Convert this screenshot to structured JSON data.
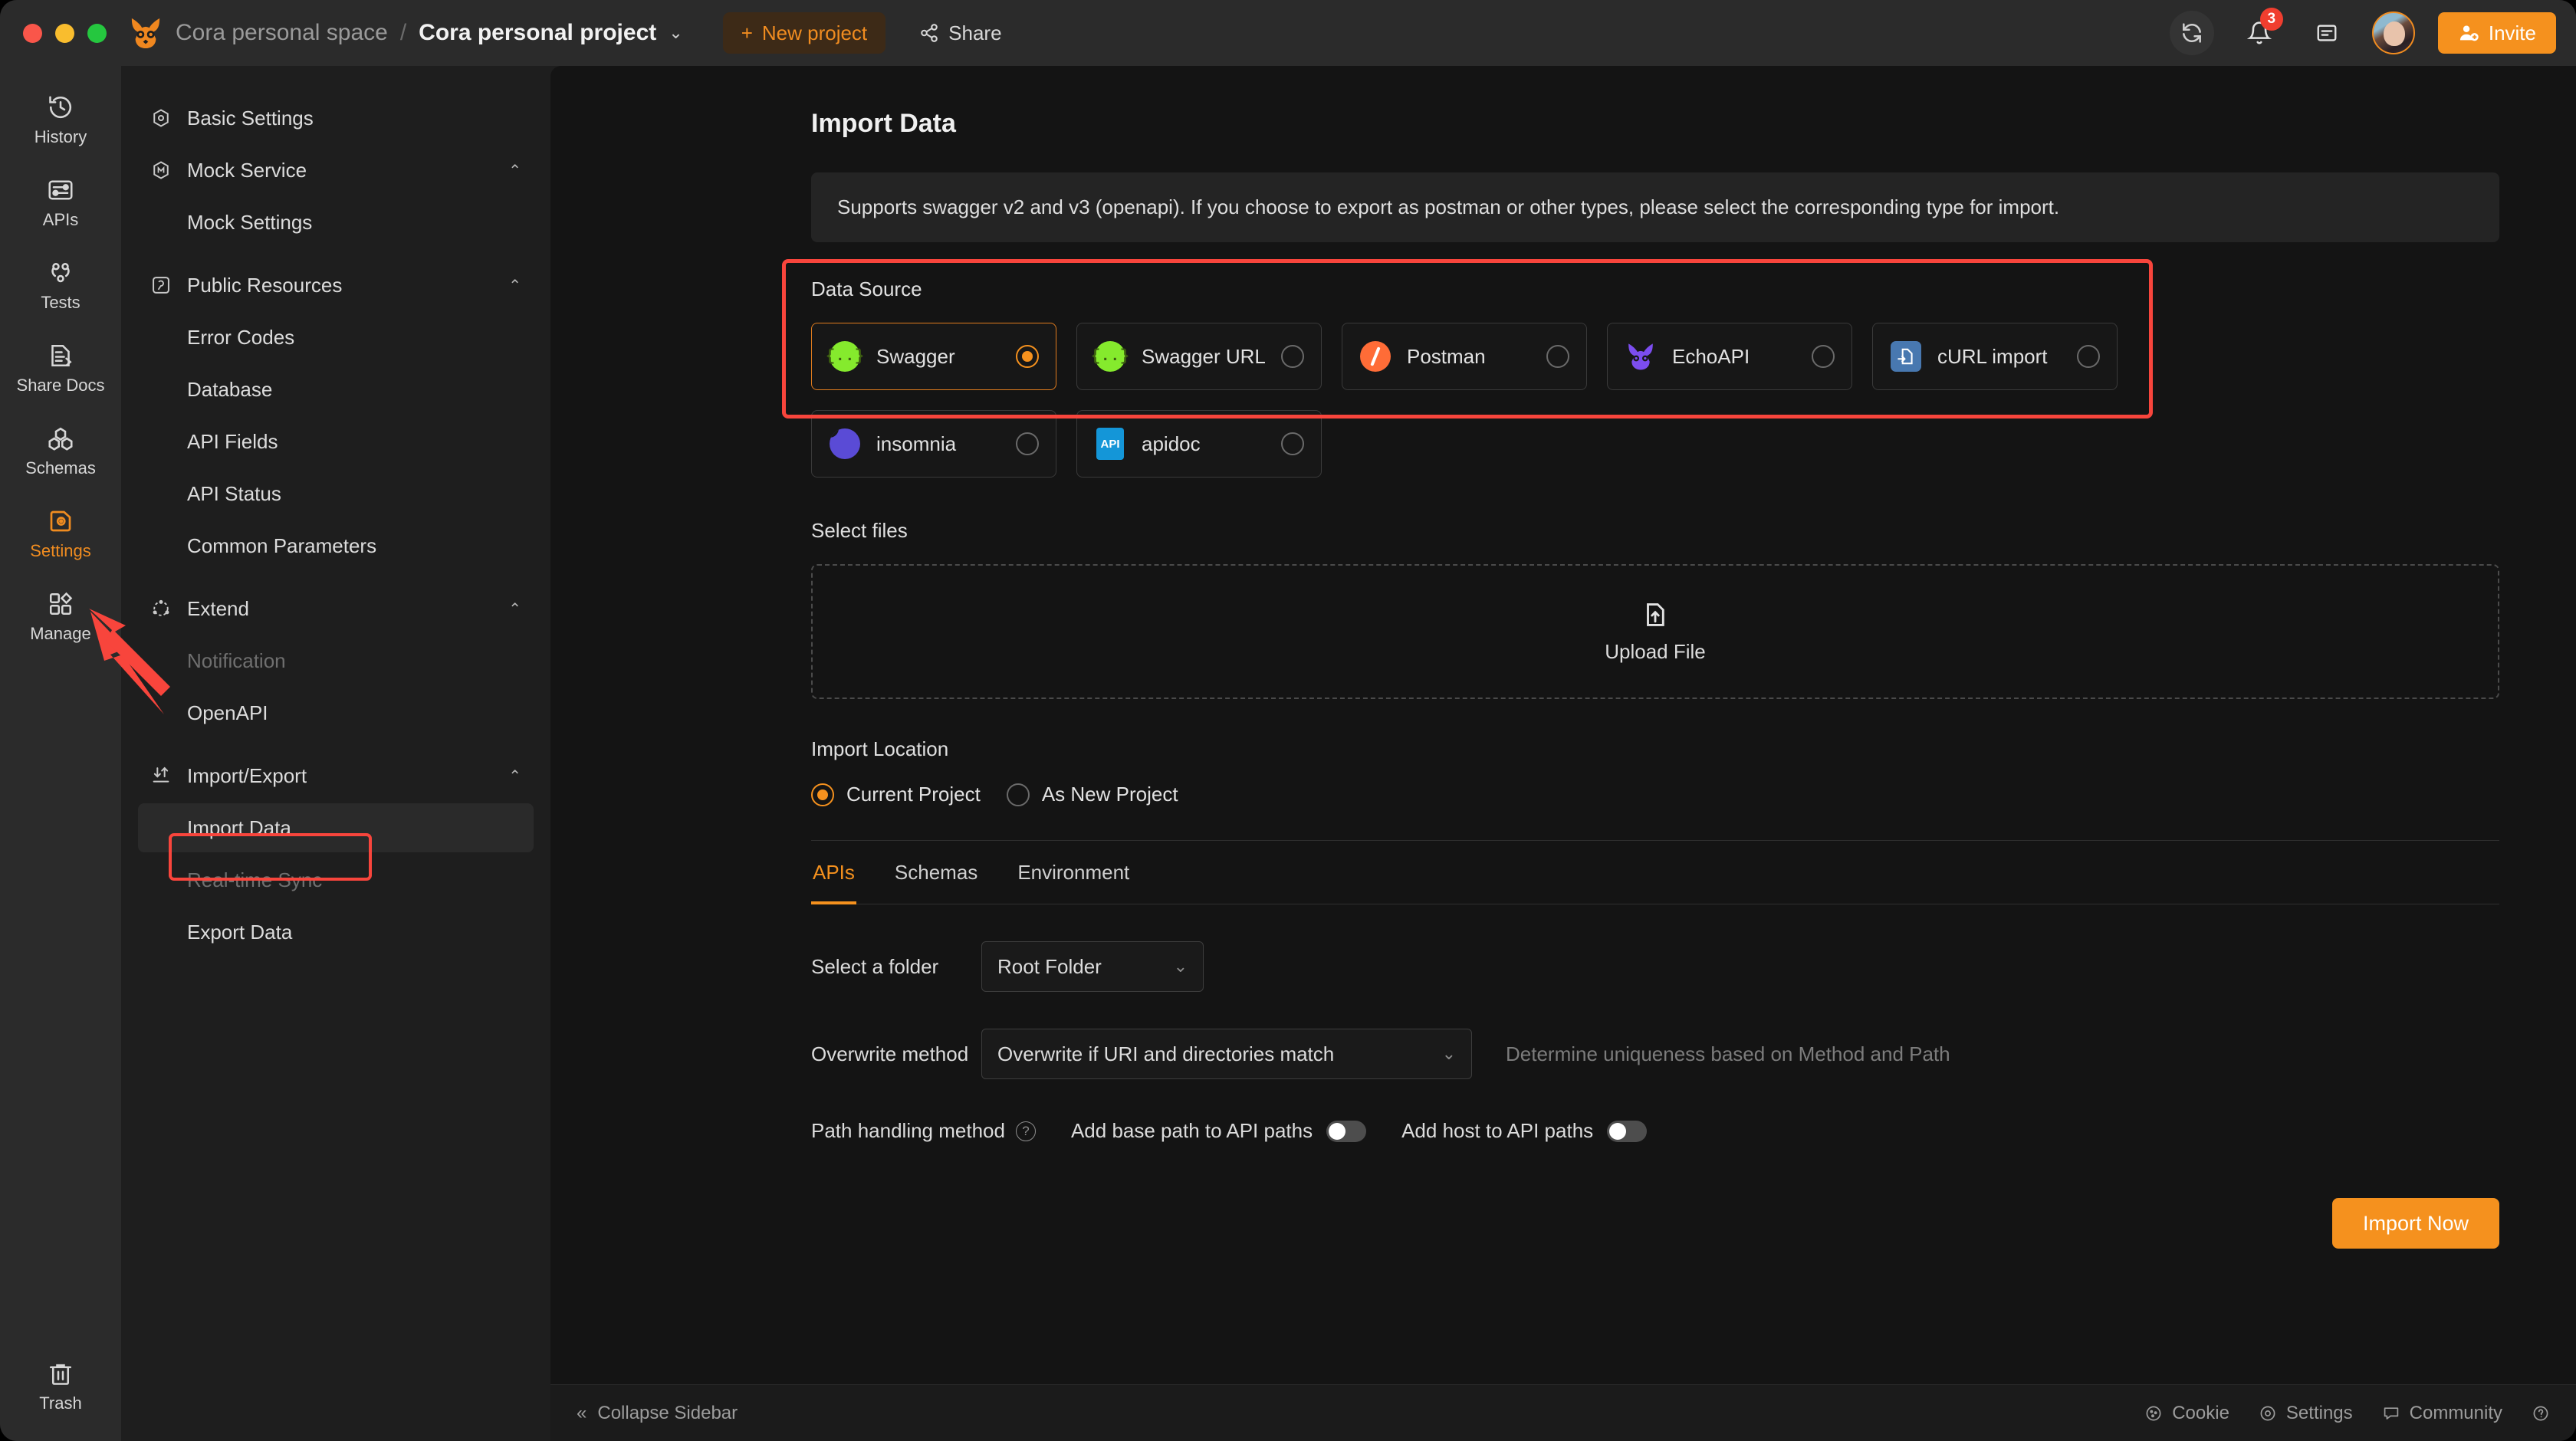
{
  "titlebar": {
    "breadcrumb_space": "Cora personal space",
    "breadcrumb_sep": "/",
    "breadcrumb_project": "Cora personal project",
    "project_caret": "⌄",
    "new_project_label": "New project",
    "new_project_plus": "+",
    "share_label": "Share",
    "notification_count": "3",
    "invite_label": "Invite",
    "icons": {
      "sync": "sync-icon",
      "bell": "bell-icon",
      "doc": "document-icon",
      "avatar": "user-avatar",
      "invite_person": "person-add-icon"
    }
  },
  "rail": {
    "items": [
      {
        "label": "History",
        "icon": "history-icon",
        "active": false
      },
      {
        "label": "APIs",
        "icon": "apis-icon",
        "active": false
      },
      {
        "label": "Tests",
        "icon": "tests-icon",
        "active": false
      },
      {
        "label": "Share Docs",
        "icon": "share-docs-icon",
        "active": false
      },
      {
        "label": "Schemas",
        "icon": "schemas-icon",
        "active": false
      },
      {
        "label": "Settings",
        "icon": "settings-icon",
        "active": true
      },
      {
        "label": "Manage",
        "icon": "manage-icon",
        "active": false
      }
    ],
    "trash": {
      "label": "Trash",
      "icon": "trash-icon"
    }
  },
  "subnav": {
    "basic_settings": "Basic Settings",
    "mock_service": "Mock Service",
    "mock_settings": "Mock Settings",
    "public_resources": "Public Resources",
    "error_codes": "Error Codes",
    "database": "Database",
    "api_fields": "API Fields",
    "api_status": "API Status",
    "common_parameters": "Common Parameters",
    "extend": "Extend",
    "notification": "Notification",
    "openapi": "OpenAPI",
    "import_export": "Import/Export",
    "import_data": "Import Data",
    "realtime_sync": "Real-time Sync",
    "export_data": "Export Data",
    "chevron": "⌃"
  },
  "main": {
    "page_title": "Import Data",
    "notice": "Supports swagger v2 and v3 (openapi). If you choose to export as postman or other types, please select the corresponding type for import.",
    "data_source_label": "Data Source",
    "data_sources": [
      {
        "name": "Swagger",
        "logo": "swagger-logo",
        "selected": true
      },
      {
        "name": "Swagger URL",
        "logo": "swagger-logo",
        "selected": false
      },
      {
        "name": "Postman",
        "logo": "postman-logo",
        "selected": false
      },
      {
        "name": "EchoAPI",
        "logo": "echoapi-logo",
        "selected": false
      },
      {
        "name": "cURL import",
        "logo": "curl-logo",
        "selected": false
      },
      {
        "name": "insomnia",
        "logo": "insomnia-logo",
        "selected": false
      },
      {
        "name": "apidoc",
        "logo": "apidoc-logo",
        "selected": false
      }
    ],
    "select_files_label": "Select files",
    "upload_label": "Upload File",
    "import_location_label": "Import Location",
    "location_options": [
      {
        "label": "Current Project",
        "selected": true
      },
      {
        "label": "As New Project",
        "selected": false
      }
    ],
    "tabs": [
      {
        "label": "APIs",
        "active": true
      },
      {
        "label": "Schemas",
        "active": false
      },
      {
        "label": "Environment",
        "active": false
      }
    ],
    "folder_label": "Select a folder",
    "folder_value": "Root Folder",
    "overwrite_label": "Overwrite method",
    "overwrite_value": "Overwrite if URI and directories match",
    "overwrite_hint": "Determine uniqueness based on Method and Path",
    "path_handling_label": "Path handling method",
    "toggle_base_path": "Add base path to API paths",
    "toggle_host": "Add host to API paths",
    "import_now_label": "Import Now",
    "caret": "⌄"
  },
  "footer": {
    "collapse_label": "Collapse Sidebar",
    "collapse_icon": "«",
    "items": [
      {
        "label": "Cookie",
        "icon": "cookie-icon"
      },
      {
        "label": "Settings",
        "icon": "gear-icon"
      },
      {
        "label": "Community",
        "icon": "community-icon"
      }
    ],
    "help_icon": "help-icon"
  },
  "colors": {
    "accent": "#f5911e",
    "annotation": "#f8453c",
    "window_bg": "#1e1e1e",
    "content_bg": "#141414"
  }
}
